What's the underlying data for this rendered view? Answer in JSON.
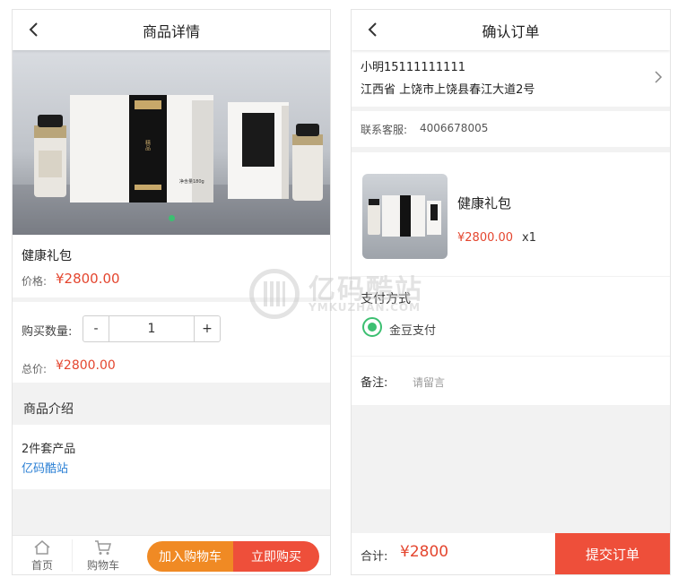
{
  "left": {
    "header_title": "商品详情",
    "product_name": "健康礼包",
    "price_label": "价格:",
    "price": "¥2800.00",
    "qty_label": "购买数量:",
    "qty_minus": "-",
    "qty_value": "1",
    "qty_plus": "+",
    "total_label": "总价:",
    "total": "¥2800.00",
    "intro_title": "商品介绍",
    "intro_line1": "2件套产品",
    "intro_link": "亿码酷站",
    "tab_home": "首页",
    "tab_cart": "购物车",
    "add_cart_button": "加入购物车",
    "buy_now_button": "立即购买",
    "box_label": "净含量180g"
  },
  "right": {
    "header_title": "确认订单",
    "address_name": "小明15111111111",
    "address_line": "江西省 上饶市上饶县春江大道2号",
    "service_label": "联系客服:",
    "service_phone": "4006678005",
    "item_name": "健康礼包",
    "item_price": "¥2800.00",
    "item_qty": "x1",
    "payment_title": "支付方式",
    "payment_option": "金豆支付",
    "remark_label": "备注:",
    "remark_placeholder": "请留言",
    "total_label": "合计:",
    "total_value": "¥2800",
    "submit_button": "提交订单"
  },
  "watermark": {
    "title": "亿码酷站",
    "subtitle": "YMKUZHAN.COM"
  },
  "colors": {
    "accent_red": "#e4462f",
    "orange": "#f08a24",
    "green": "#3cbf71",
    "link_blue": "#2a7fd4"
  }
}
